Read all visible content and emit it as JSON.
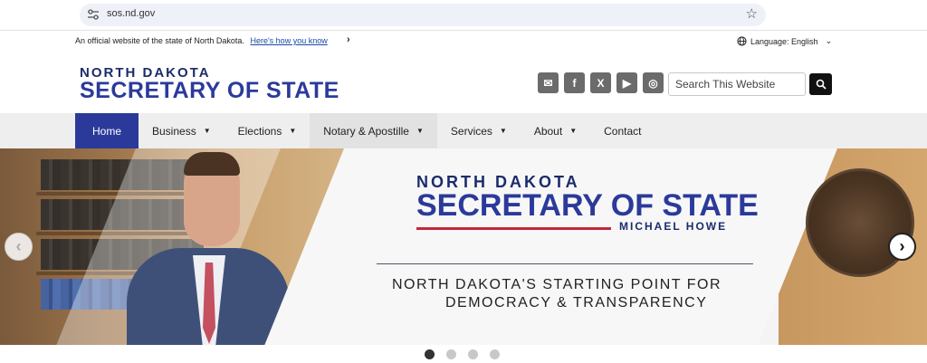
{
  "browser": {
    "url": "sos.nd.gov",
    "icons": [
      "tune-icon",
      "star-icon"
    ]
  },
  "gov_banner": {
    "text": "An official website of the state of North Dakota.",
    "link": "Here's how you know",
    "chevron": "›",
    "language": "Language: English",
    "language_chevron": "⌄"
  },
  "header": {
    "logo_top": "NORTH DAKOTA",
    "logo_main": "SECRETARY OF STATE",
    "social_icons": [
      "mail-icon",
      "facebook-icon",
      "x-icon",
      "youtube-icon",
      "instagram-icon"
    ],
    "search_placeholder": "Search This Website"
  },
  "nav": {
    "items": [
      {
        "label": "Home",
        "caret": ""
      },
      {
        "label": "Business",
        "caret": "▼"
      },
      {
        "label": "Elections",
        "caret": "▼"
      },
      {
        "label": "Notary & Apostille",
        "caret": "▼"
      },
      {
        "label": "Services",
        "caret": "▼"
      },
      {
        "label": "About",
        "caret": "▼"
      },
      {
        "label": "Contact",
        "caret": ""
      }
    ]
  },
  "hero": {
    "logo_top": "NORTH DAKOTA",
    "logo_main": "SECRETARY OF STATE",
    "name": "MICHAEL HOWE",
    "tagline_1": "NORTH DAKOTA'S STARTING POINT FOR",
    "tagline_2": "DEMOCRACY & TRANSPARENCY",
    "prev": "‹",
    "next": "›",
    "slide_count": 4,
    "active_slide": 1
  },
  "colors": {
    "brand_blue": "#2b3a9a",
    "brand_red": "#c4263a",
    "nav_bg": "#eeeeee"
  }
}
